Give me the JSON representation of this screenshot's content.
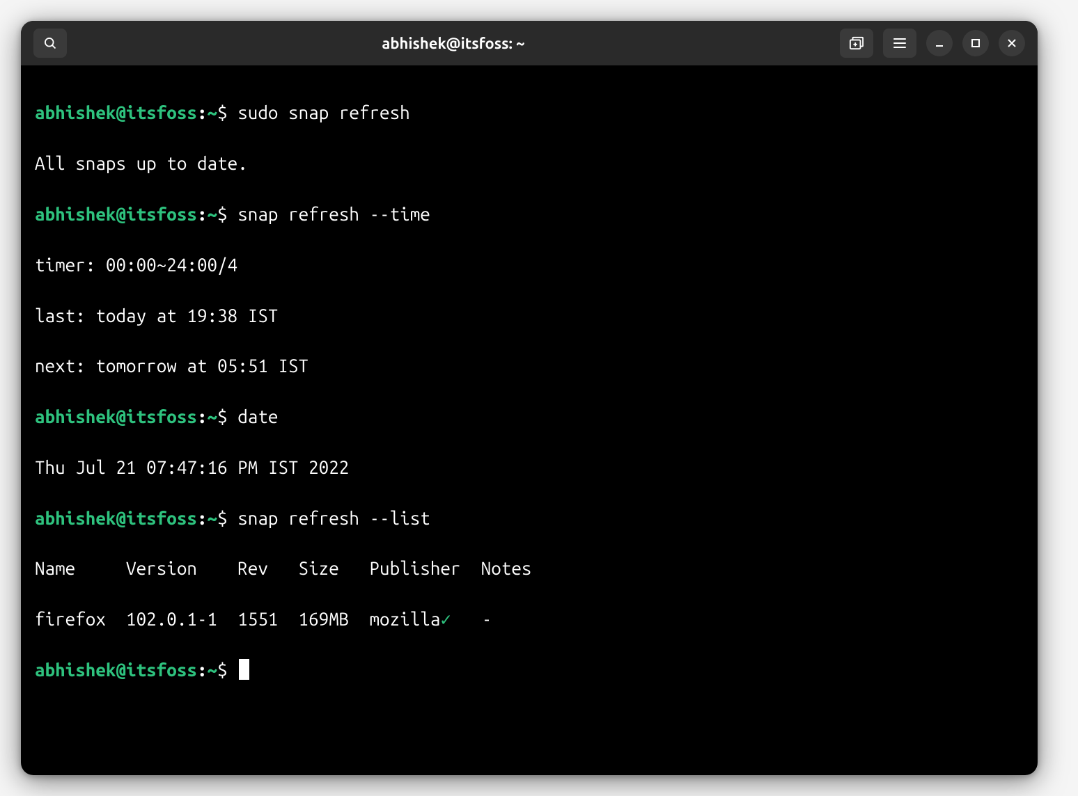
{
  "titlebar": {
    "title": "abhishek@itsfoss: ~"
  },
  "prompt": {
    "user_host": "abhishek@itsfoss",
    "colon": ":",
    "path": "~",
    "dollar": "$ "
  },
  "commands": {
    "c1": "sudo snap refresh",
    "c2": "snap refresh --time",
    "c3": "date",
    "c4": "snap refresh --list"
  },
  "output": {
    "o1": "All snaps up to date.",
    "o2a": "timer: 00:00~24:00/4",
    "o2b": "last: today at 19:38 IST",
    "o2c": "next: tomorrow at 05:51 IST",
    "o3": "Thu Jul 21 07:47:16 PM IST 2022",
    "o4header": "Name     Version    Rev   Size   Publisher  Notes",
    "o4row_pre": "firefox  102.0.1-1  1551  169MB  mozilla",
    "o4row_check": "✓",
    "o4row_post": "   -"
  }
}
